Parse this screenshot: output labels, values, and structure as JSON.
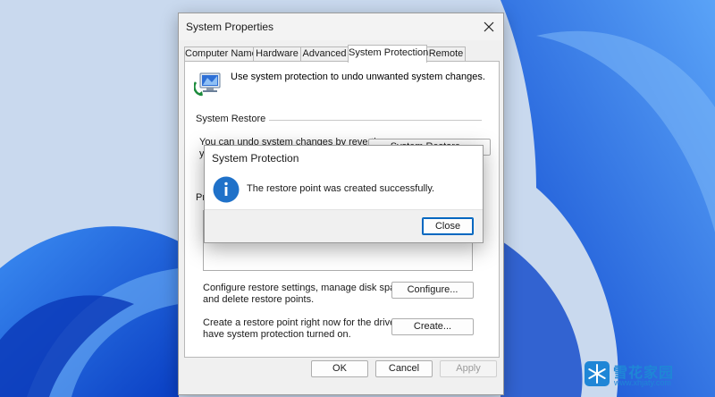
{
  "colors": {
    "wallpaper_bg": "#c6d7ee",
    "wallpaper_bloom": "#1a62e6",
    "accent": "#0067c0",
    "info_icon": "#1f71c9",
    "watermark": "#1f86d6"
  },
  "system_properties": {
    "title": "System Properties",
    "tabs": [
      {
        "label": "Computer Name",
        "active": false
      },
      {
        "label": "Hardware",
        "active": false
      },
      {
        "label": "Advanced",
        "active": false
      },
      {
        "label": "System Protection",
        "active": true
      },
      {
        "label": "Remote",
        "active": false
      }
    ],
    "intro_text": "Use system protection to undo unwanted system changes.",
    "restore_group_label": "System Restore",
    "restore_text_line1": "You can undo system changes by reverting",
    "restore_text_line2": "yo",
    "restore_button_label": "System Restore...",
    "protection_group_label": "Pro",
    "configure_text_line1": "Configure restore settings, manage disk space,",
    "configure_text_line2": "and delete restore points.",
    "configure_button_label": "Configure...",
    "create_text_line1": "Create a restore point right now for the drives that",
    "create_text_line2": "have system protection turned on.",
    "create_button_label": "Create...",
    "ok_label": "OK",
    "cancel_label": "Cancel",
    "apply_label": "Apply"
  },
  "message_box": {
    "title": "System Protection",
    "icon": "info-icon",
    "message": "The restore point was created successfully.",
    "close_label": "Close"
  },
  "watermark": {
    "name": "雪花家园",
    "url": "www.xhjaty.com"
  }
}
